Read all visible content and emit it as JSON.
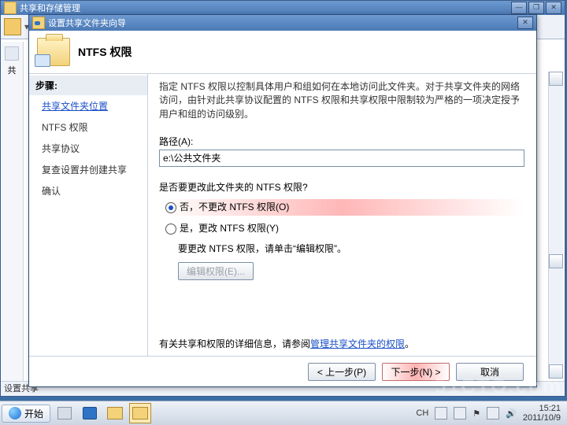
{
  "back_window": {
    "title": "共享和存储管理",
    "status": "设置共享"
  },
  "wizard": {
    "title": "设置共享文件夹向导",
    "heading": "NTFS 权限",
    "steps_header": "步骤:",
    "steps": [
      "共享文件夹位置",
      "NTFS 权限",
      "共享协议",
      "复查设置并创建共享",
      "确认"
    ],
    "active_step_index": 0,
    "description": "指定 NTFS 权限以控制具体用户和组如何在本地访问此文件夹。对于共享文件夹的网络访问，由针对此共享协议配置的 NTFS 权限和共享权限中限制较为严格的一项决定授予用户和组的访问级别。",
    "path_label": "路径(A):",
    "path_value": "e:\\公共文件夹",
    "question": "是否要更改此文件夹的 NTFS 权限?",
    "radio_no": "否，不更改 NTFS 权限(O)",
    "radio_yes": "是，更改 NTFS 权限(Y)",
    "selected_radio": "no",
    "yes_hint": "要更改 NTFS 权限，请单击“编辑权限”。",
    "edit_btn": "编辑权限(E)...",
    "help_prefix": "有关共享和权限的详细信息，请参阅",
    "help_link": "管理共享文件夹的权限",
    "btn_prev": "< 上一步(P)",
    "btn_next": "下一步(N) >",
    "btn_cancel": "取消"
  },
  "taskbar": {
    "start": "开始",
    "lang": "CH",
    "time": "15:21",
    "date": "2011/10/9"
  },
  "watermark": "51CTO.com"
}
